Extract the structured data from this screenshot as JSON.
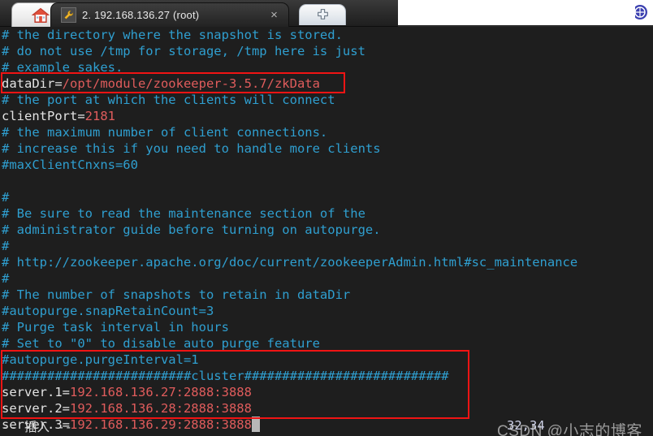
{
  "window": {
    "tabs": [
      {
        "name": "home-tab",
        "icon": "home-icon",
        "label": ""
      },
      {
        "name": "session-tab",
        "icon": "wrench-icon",
        "label": "2. 192.168.136.27 (root)",
        "active": true
      },
      {
        "name": "new-tab",
        "icon": "plus-icon",
        "label": ""
      }
    ],
    "close_label": "×",
    "right_edge_icon": "app-logo-icon"
  },
  "terminal": {
    "file_type": "zoo.cfg",
    "lines": [
      {
        "id": "l1",
        "segs": [
          {
            "t": "# the directory where the snapshot is stored.",
            "c": "comment"
          }
        ]
      },
      {
        "id": "l2",
        "segs": [
          {
            "t": "# do not use /tmp for storage, /tmp here is just",
            "c": "comment"
          }
        ]
      },
      {
        "id": "l3",
        "segs": [
          {
            "t": "# example sakes.",
            "c": "comment"
          }
        ]
      },
      {
        "id": "l4",
        "segs": [
          {
            "t": "dataDir=",
            "c": "key"
          },
          {
            "t": "/opt/module/zookeeper-3.5.7/zkData",
            "c": "val"
          }
        ]
      },
      {
        "id": "l5",
        "segs": [
          {
            "t": "# the port at which the clients will connect",
            "c": "comment"
          }
        ]
      },
      {
        "id": "l6",
        "segs": [
          {
            "t": "clientPort=",
            "c": "key"
          },
          {
            "t": "2181",
            "c": "val"
          }
        ]
      },
      {
        "id": "l7",
        "segs": [
          {
            "t": "# the maximum number of client connections.",
            "c": "comment"
          }
        ]
      },
      {
        "id": "l8",
        "segs": [
          {
            "t": "# increase this if you need to handle more clients",
            "c": "comment"
          }
        ]
      },
      {
        "id": "l9",
        "segs": [
          {
            "t": "#maxClientCnxns=60",
            "c": "comment"
          }
        ]
      },
      {
        "id": "l10",
        "segs": [
          {
            "t": "",
            "c": "comment"
          }
        ]
      },
      {
        "id": "l11",
        "segs": [
          {
            "t": "#",
            "c": "comment"
          }
        ]
      },
      {
        "id": "l12",
        "segs": [
          {
            "t": "# Be sure to read the maintenance section of the",
            "c": "comment"
          }
        ]
      },
      {
        "id": "l13",
        "segs": [
          {
            "t": "# administrator guide before turning on autopurge.",
            "c": "comment"
          }
        ]
      },
      {
        "id": "l14",
        "segs": [
          {
            "t": "#",
            "c": "comment"
          }
        ]
      },
      {
        "id": "l15",
        "segs": [
          {
            "t": "# http://zookeeper.apache.org/doc/current/zookeeperAdmin.html#sc_maintenance",
            "c": "comment"
          }
        ]
      },
      {
        "id": "l16",
        "segs": [
          {
            "t": "#",
            "c": "comment"
          }
        ]
      },
      {
        "id": "l17",
        "segs": [
          {
            "t": "# The number of snapshots to retain in dataDir",
            "c": "comment"
          }
        ]
      },
      {
        "id": "l18",
        "segs": [
          {
            "t": "#autopurge.snapRetainCount=3",
            "c": "comment"
          }
        ]
      },
      {
        "id": "l19",
        "segs": [
          {
            "t": "# Purge task interval in hours",
            "c": "comment"
          }
        ]
      },
      {
        "id": "l20",
        "segs": [
          {
            "t": "# Set to \"0\" to disable auto purge feature",
            "c": "comment"
          }
        ]
      },
      {
        "id": "l21",
        "segs": [
          {
            "t": "#autopurge.purgeInterval=1",
            "c": "comment"
          }
        ]
      },
      {
        "id": "l22",
        "segs": [
          {
            "t": "#########################cluster###########################",
            "c": "comment"
          }
        ]
      },
      {
        "id": "l23",
        "segs": [
          {
            "t": "server.1=",
            "c": "key"
          },
          {
            "t": "192.168.136.27:2888:3888",
            "c": "val"
          }
        ]
      },
      {
        "id": "l24",
        "segs": [
          {
            "t": "server.2=",
            "c": "key"
          },
          {
            "t": "192.168.136.28:2888:3888",
            "c": "val"
          }
        ]
      },
      {
        "id": "l25",
        "segs": [
          {
            "t": "server.3=",
            "c": "key"
          },
          {
            "t": "192.168.136.29:2888:3888",
            "c": "val",
            "cursor": true
          }
        ]
      }
    ],
    "status_mode": "-- 插入 --",
    "cursor_position": "32,34"
  },
  "annotations": {
    "box_color": "#f01414",
    "boxes": [
      {
        "name": "datadir-highlight",
        "target": "dataDir line"
      },
      {
        "name": "cluster-highlight",
        "target": "cluster server lines"
      }
    ]
  },
  "watermark": {
    "text": "CSDN @小志的博客"
  }
}
